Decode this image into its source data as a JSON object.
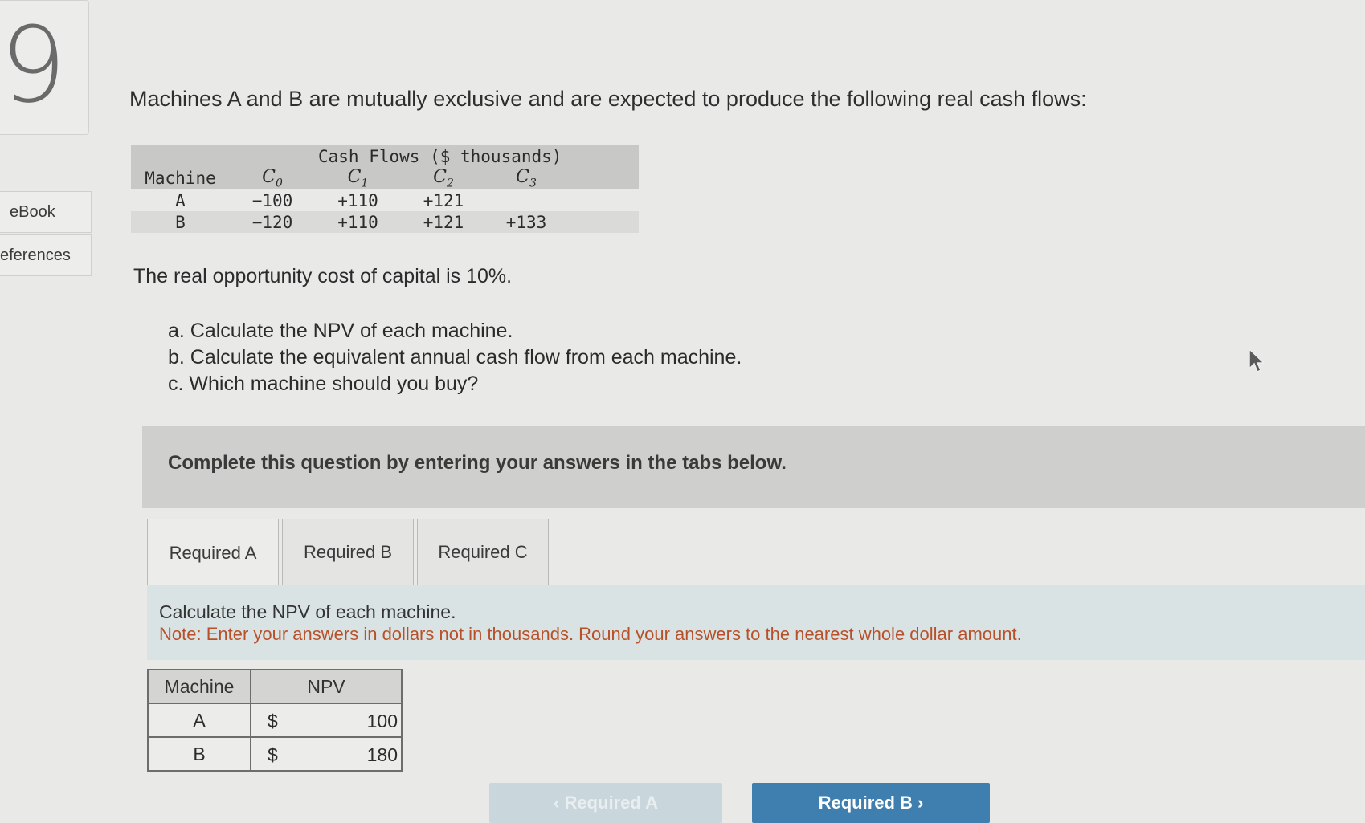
{
  "question_number": "9",
  "sidebar": {
    "ebook_label": "eBook",
    "references_label": "eferences"
  },
  "intro_text": "Machines A and B are mutually exclusive and are expected to produce the following real cash flows:",
  "cash_flow_table": {
    "title": "Cash Flows ($ thousands)",
    "machine_header": "Machine",
    "col_base": "C",
    "col_subs": [
      "0",
      "1",
      "2",
      "3"
    ],
    "rows": [
      {
        "machine": "A",
        "c0": "−100",
        "c1": "+110",
        "c2": "+121",
        "c3": ""
      },
      {
        "machine": "B",
        "c0": "−120",
        "c1": "+110",
        "c2": "+121",
        "c3": "+133"
      }
    ]
  },
  "opportunity_cost_text": "The real opportunity cost of capital is 10%.",
  "questions": [
    "a. Calculate the NPV of each machine.",
    "b. Calculate the equivalent annual cash flow from each machine.",
    "c. Which machine should you buy?"
  ],
  "complete_banner": "Complete this question by entering your answers in the tabs below.",
  "tabs": [
    {
      "label": "Required A",
      "active": true
    },
    {
      "label": "Required B",
      "active": false
    },
    {
      "label": "Required C",
      "active": false
    }
  ],
  "instruction": {
    "line1": "Calculate the NPV of each machine.",
    "note": "Note: Enter your answers in dollars not in thousands. Round your answers to the nearest whole dollar amount."
  },
  "npv_table": {
    "headers": [
      "Machine",
      "NPV"
    ],
    "rows": [
      {
        "machine": "A",
        "currency": "$",
        "value": "100"
      },
      {
        "machine": "B",
        "currency": "$",
        "value": "180"
      }
    ]
  },
  "nav": {
    "prev_label": "‹  Required A",
    "next_label": "Required B  ›"
  },
  "colors": {
    "note": "#b8512a",
    "next_button": "#3f7fb0",
    "instruction_bg": "#d9e3e3"
  }
}
